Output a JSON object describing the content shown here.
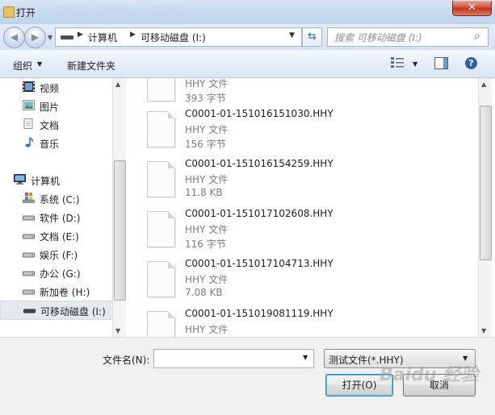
{
  "window": {
    "title": "打开",
    "close_glyph": "✕"
  },
  "nav": {
    "back_glyph": "◀",
    "forward_glyph": "▶",
    "breadcrumb": [
      "计算机",
      "可移动磁盘 (I:)"
    ],
    "search_placeholder": "搜索 可移动磁盘 (I:)"
  },
  "toolbar": {
    "organize_label": "组织",
    "new_folder_label": "新建文件夹",
    "help_glyph": "?"
  },
  "sidebar": {
    "items": [
      {
        "label": "视频",
        "icon": "video-icon"
      },
      {
        "label": "图片",
        "icon": "picture-icon"
      },
      {
        "label": "文档",
        "icon": "document-icon"
      },
      {
        "label": "音乐",
        "icon": "music-icon"
      },
      {
        "label": "计算机",
        "icon": "computer-icon"
      },
      {
        "label": "系统 (C:)",
        "icon": "windows-drive-icon"
      },
      {
        "label": "软件 (D:)",
        "icon": "drive-icon"
      },
      {
        "label": "文档 (E:)",
        "icon": "drive-icon"
      },
      {
        "label": "娱乐 (F:)",
        "icon": "drive-icon"
      },
      {
        "label": "办公 (G:)",
        "icon": "drive-icon"
      },
      {
        "label": "新加卷 (H:)",
        "icon": "drive-icon"
      },
      {
        "label": "可移动磁盘 (I:)",
        "icon": "removable-drive-icon",
        "selected": true
      }
    ]
  },
  "files": [
    {
      "name": "",
      "type": "HHY 文件",
      "size": "393 字节"
    },
    {
      "name": "C0001-01-151016151030.HHY",
      "type": "HHY 文件",
      "size": "156 字节"
    },
    {
      "name": "C0001-01-151016154259.HHY",
      "type": "HHY 文件",
      "size": "11.8 KB"
    },
    {
      "name": "C0001-01-151017102608.HHY",
      "type": "HHY 文件",
      "size": "116 字节"
    },
    {
      "name": "C0001-01-151017104713.HHY",
      "type": "HHY 文件",
      "size": "7.08 KB"
    },
    {
      "name": "C0001-01-151019081119.HHY",
      "type": "HHY 文件",
      "size": ""
    }
  ],
  "bottom": {
    "filename_label": "文件名(N):",
    "filename_value": "",
    "filter_value": "测试文件(*.HHY)",
    "open_label": "打开(O)",
    "cancel_label": "取消"
  },
  "colors": {
    "accent": "#3c7fb1",
    "close_red": "#c0321a",
    "selection": "#e5e9ee"
  },
  "watermark": "Baidu 经验"
}
